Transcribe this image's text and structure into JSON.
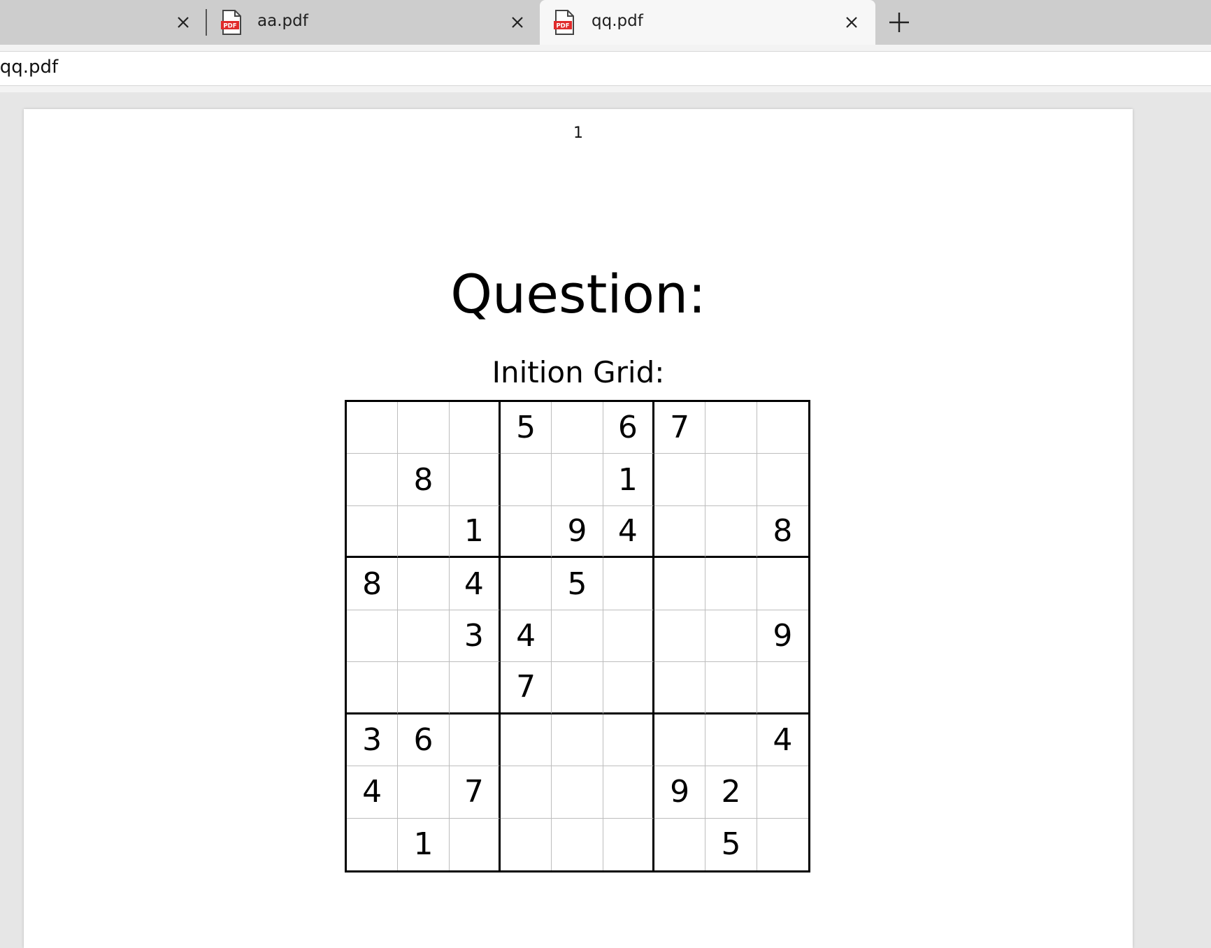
{
  "tabs": [
    {
      "title": "",
      "active": false,
      "icon": ""
    },
    {
      "title": "aa.pdf",
      "active": false,
      "icon": "pdf-file-icon"
    },
    {
      "title": "qq.pdf",
      "active": true,
      "icon": "pdf-file-icon"
    }
  ],
  "icons": {
    "close": "close-icon",
    "new_tab": "plus-icon",
    "pdf": "pdf-file-icon"
  },
  "address_bar": {
    "url": "/qq.pdf"
  },
  "document": {
    "page_number": "1",
    "title": "Question:",
    "subtitle": "Inition Grid:",
    "grid": [
      [
        "",
        "",
        "",
        "5",
        "",
        "6",
        "7",
        "",
        ""
      ],
      [
        "",
        "8",
        "",
        "",
        "",
        "1",
        "",
        "",
        ""
      ],
      [
        "",
        "",
        "1",
        "",
        "9",
        "4",
        "",
        "",
        "8"
      ],
      [
        "8",
        "",
        "4",
        "",
        "5",
        "",
        "",
        "",
        ""
      ],
      [
        "",
        "",
        "3",
        "4",
        "",
        "",
        "",
        "",
        "9"
      ],
      [
        "",
        "",
        "",
        "7",
        "",
        "",
        "",
        "",
        ""
      ],
      [
        "3",
        "6",
        "",
        "",
        "",
        "",
        "",
        "",
        "4"
      ],
      [
        "4",
        "",
        "7",
        "",
        "",
        "",
        "9",
        "2",
        ""
      ],
      [
        "",
        "1",
        "",
        "",
        "",
        "",
        "",
        "5",
        ""
      ]
    ]
  },
  "colors": {
    "tabstrip": "#cdcdcd",
    "active_tab": "#f7f7f7",
    "viewer_bg": "#e6e6e6",
    "pdf_icon_red": "#e02b2b"
  }
}
